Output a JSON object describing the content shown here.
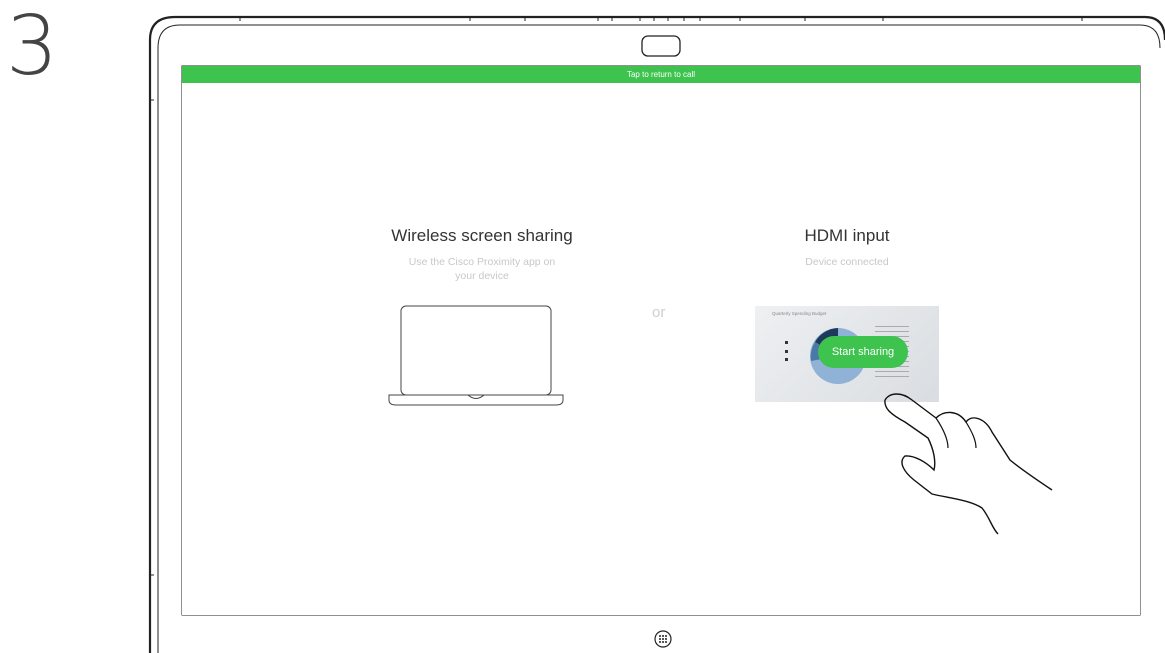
{
  "step": {
    "number": "3"
  },
  "banner": {
    "label": "Tap to return to call",
    "color": "#3dc34e"
  },
  "wireless": {
    "title": "Wireless screen sharing",
    "description_line1": "Use the Cisco Proximity app on",
    "description_line2": "your device",
    "icon": "laptop-icon"
  },
  "divider": {
    "label": "or"
  },
  "hdmi": {
    "title": "HDMI input",
    "status": "Device connected",
    "preview_title": "Quarterly Spending Budget",
    "start_label": "Start sharing"
  },
  "icons": {
    "camera": "camera-icon",
    "home": "home-grid-icon",
    "hand": "pointing-hand-icon"
  },
  "colors": {
    "accent": "#3dc34e"
  }
}
